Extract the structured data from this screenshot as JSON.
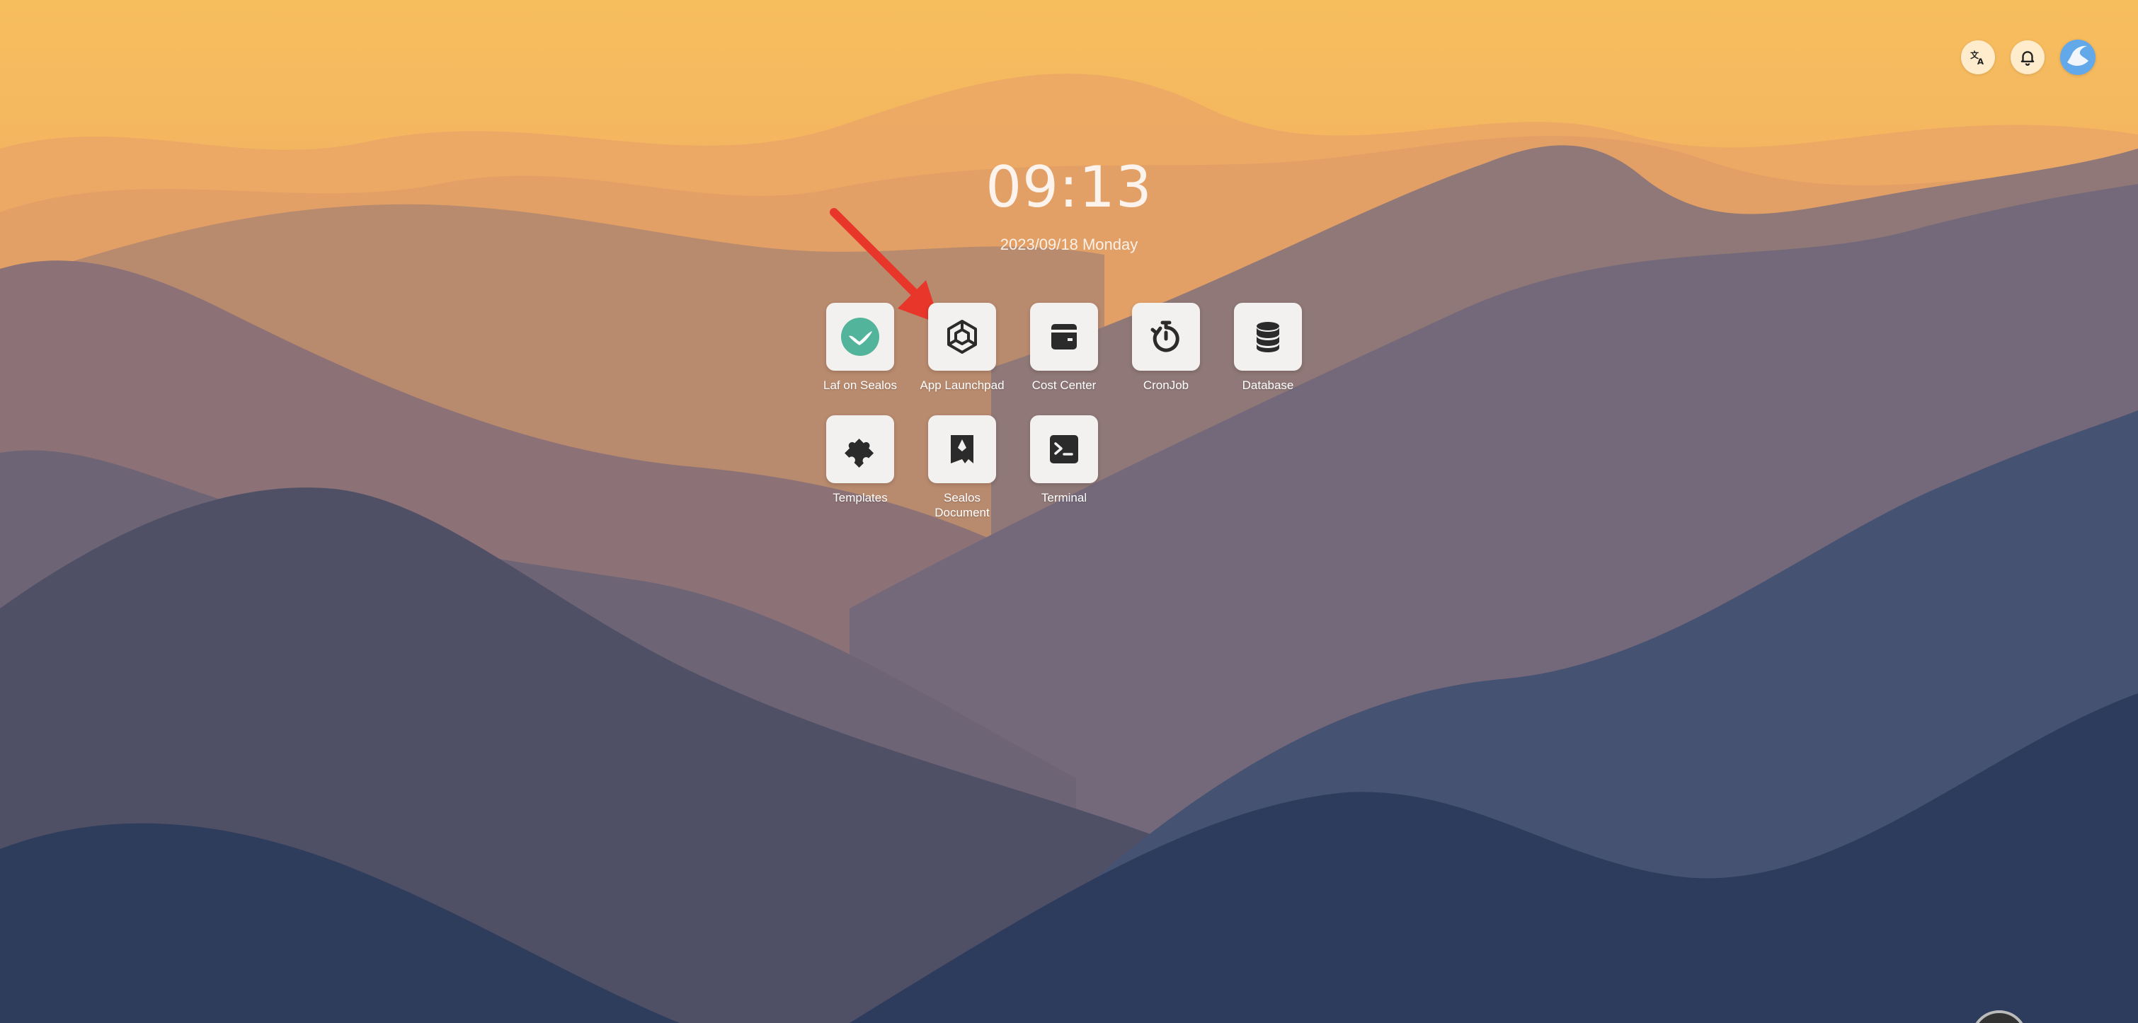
{
  "clock": {
    "time": "09:13",
    "date": "2023/09/18 Monday"
  },
  "top_controls": {
    "language_icon": "translate-icon",
    "notification_icon": "bell-icon",
    "avatar_icon": "user-avatar"
  },
  "apps": [
    {
      "label": "Laf on Sealos",
      "icon": "laf-logo-icon"
    },
    {
      "label": "App Launchpad",
      "icon": "cube-icon"
    },
    {
      "label": "Cost Center",
      "icon": "wallet-icon"
    },
    {
      "label": "CronJob",
      "icon": "timer-icon"
    },
    {
      "label": "Database",
      "icon": "database-icon"
    },
    {
      "label": "Templates",
      "icon": "puzzle-icon"
    },
    {
      "label": "Sealos Document",
      "icon": "bookmark-icon"
    },
    {
      "label": "Terminal",
      "icon": "terminal-icon"
    }
  ],
  "colors": {
    "sky_top": "#f8c35f",
    "arrow": "#e8362a",
    "laf_green": "#52b49a",
    "icon_dark": "#2b2b2b"
  }
}
